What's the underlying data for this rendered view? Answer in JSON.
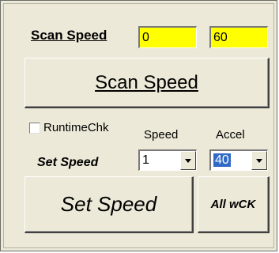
{
  "scan": {
    "label": "Scan Speed",
    "start_value": "0",
    "end_value": "60",
    "field_color": "#ffff00",
    "button_label": "Scan Speed"
  },
  "runtime_check": {
    "label": "RuntimeChk",
    "checked": false
  },
  "speed": {
    "header": "Speed",
    "selected": "1"
  },
  "accel": {
    "header": "Accel",
    "selected": "40",
    "highlight_color": "#316ac5"
  },
  "set_speed": {
    "label": "Set Speed",
    "button_label": "Set Speed"
  },
  "all_wck": {
    "button_label": "All wCK"
  },
  "icons": {
    "dropdown": "chevron-down-icon"
  }
}
